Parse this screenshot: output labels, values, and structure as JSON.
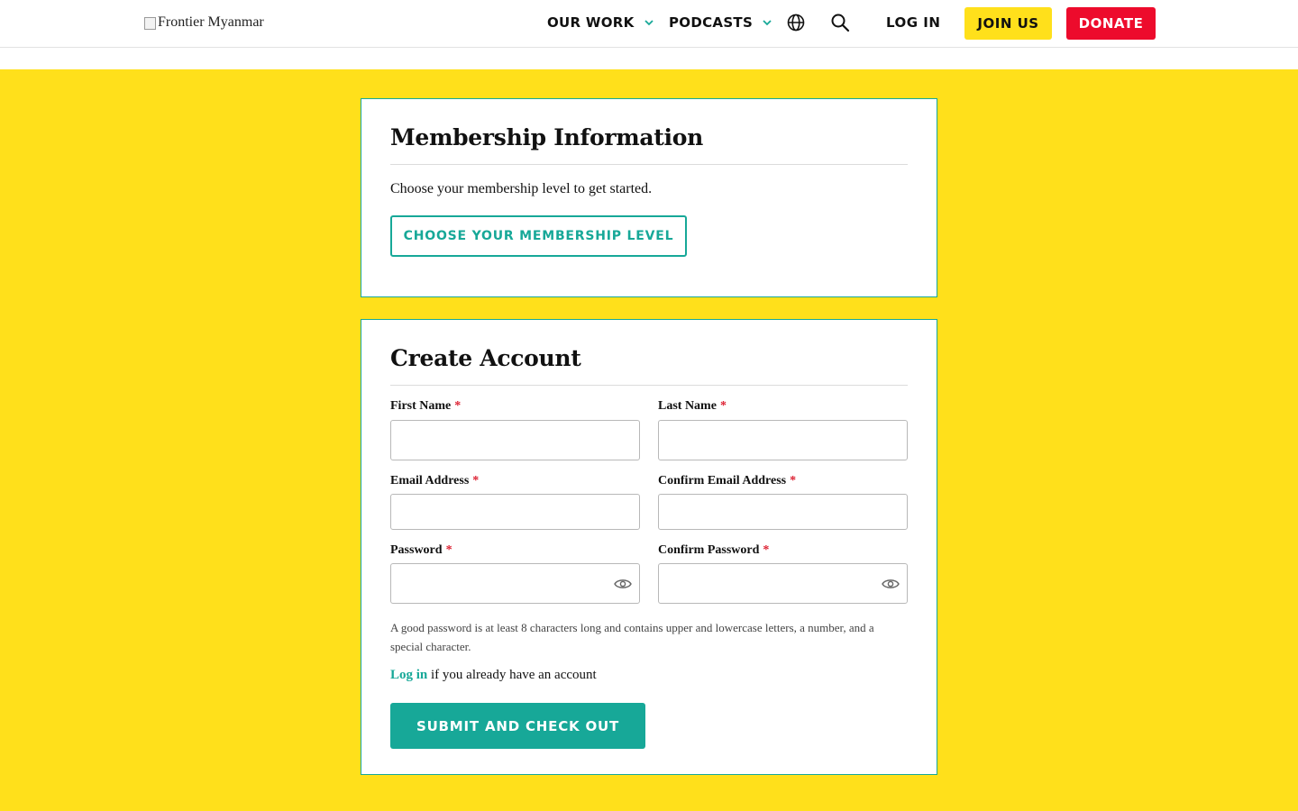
{
  "header": {
    "logo_alt": "Frontier Myanmar",
    "nav": [
      {
        "label": "OUR WORK",
        "icon": "chevron-down-icon"
      },
      {
        "label": "PODCASTS",
        "icon": "chevron-down-icon"
      }
    ],
    "language_icon": "globe-icon",
    "search_icon": "search-icon",
    "login_label": "LOG IN",
    "join_label": "JOIN US",
    "donate_label": "DONATE"
  },
  "colors": {
    "accent_yellow": "#ffe01b",
    "accent_teal": "#17a898",
    "donate_red": "#ed0b2c"
  },
  "membership": {
    "title": "Membership Information",
    "description": "Choose your membership level to get started.",
    "choose_button": "CHOOSE YOUR MEMBERSHIP LEVEL"
  },
  "account": {
    "title": "Create Account",
    "required_marker": "*",
    "fields": {
      "first_name": {
        "label": "First Name",
        "value": ""
      },
      "last_name": {
        "label": "Last Name",
        "value": ""
      },
      "email": {
        "label": "Email Address",
        "value": ""
      },
      "confirm_email": {
        "label": "Confirm Email Address",
        "value": ""
      },
      "password": {
        "label": "Password",
        "value": "",
        "icon": "eye-icon"
      },
      "confirm_password": {
        "label": "Confirm Password",
        "value": "",
        "icon": "eye-icon"
      }
    },
    "password_hint": "A good password is at least 8 characters long and contains upper and lowercase letters, a number, and a special character.",
    "login_link": "Log in",
    "login_suffix": " if you already have an account",
    "submit_button": "SUBMIT AND CHECK OUT"
  }
}
